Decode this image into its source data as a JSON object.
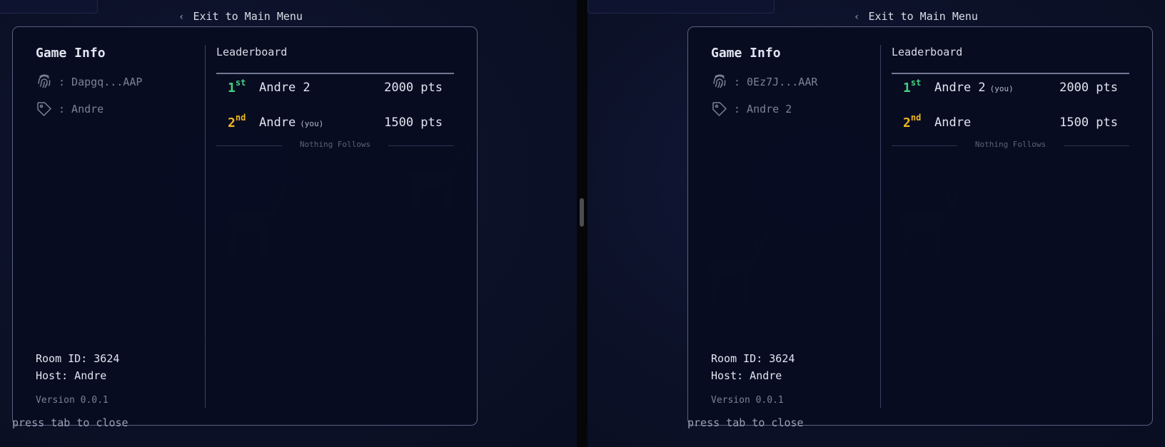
{
  "panes": [
    {
      "exit_label": "Exit to Main Menu",
      "game_info": {
        "title": "Game Info",
        "fingerprint": ": Dapgq...AAP",
        "tag": ": Andre",
        "room_id": "Room ID: 3624",
        "host": "Host: Andre",
        "version": "Version 0.0.1"
      },
      "leaderboard": {
        "title": "Leaderboard",
        "rows": [
          {
            "rank_num": "1",
            "rank_suffix": "st",
            "name": "Andre 2",
            "you": "",
            "points": "2000 pts"
          },
          {
            "rank_num": "2",
            "rank_suffix": "nd",
            "name": "Andre",
            "you": "(you)",
            "points": "1500 pts"
          }
        ],
        "footer": "Nothing Follows"
      },
      "hint": "press tab to close"
    },
    {
      "exit_label": "Exit to Main Menu",
      "game_info": {
        "title": "Game Info",
        "fingerprint": ": 0Ez7J...AAR",
        "tag": ": Andre 2",
        "room_id": "Room ID: 3624",
        "host": "Host: Andre",
        "version": "Version 0.0.1"
      },
      "leaderboard": {
        "title": "Leaderboard",
        "rows": [
          {
            "rank_num": "1",
            "rank_suffix": "st",
            "name": "Andre 2",
            "you": "(you)",
            "points": "2000 pts"
          },
          {
            "rank_num": "2",
            "rank_suffix": "nd",
            "name": "Andre",
            "you": "",
            "points": "1500 pts"
          }
        ],
        "footer": "Nothing Follows"
      },
      "hint": "press tab to close"
    }
  ],
  "colors": {
    "first_place": "#45d07e",
    "second_place": "#f0b81e",
    "panel_border": "#5a6080"
  },
  "icons": [
    "chevron-left-icon",
    "fingerprint-icon",
    "tag-icon"
  ]
}
